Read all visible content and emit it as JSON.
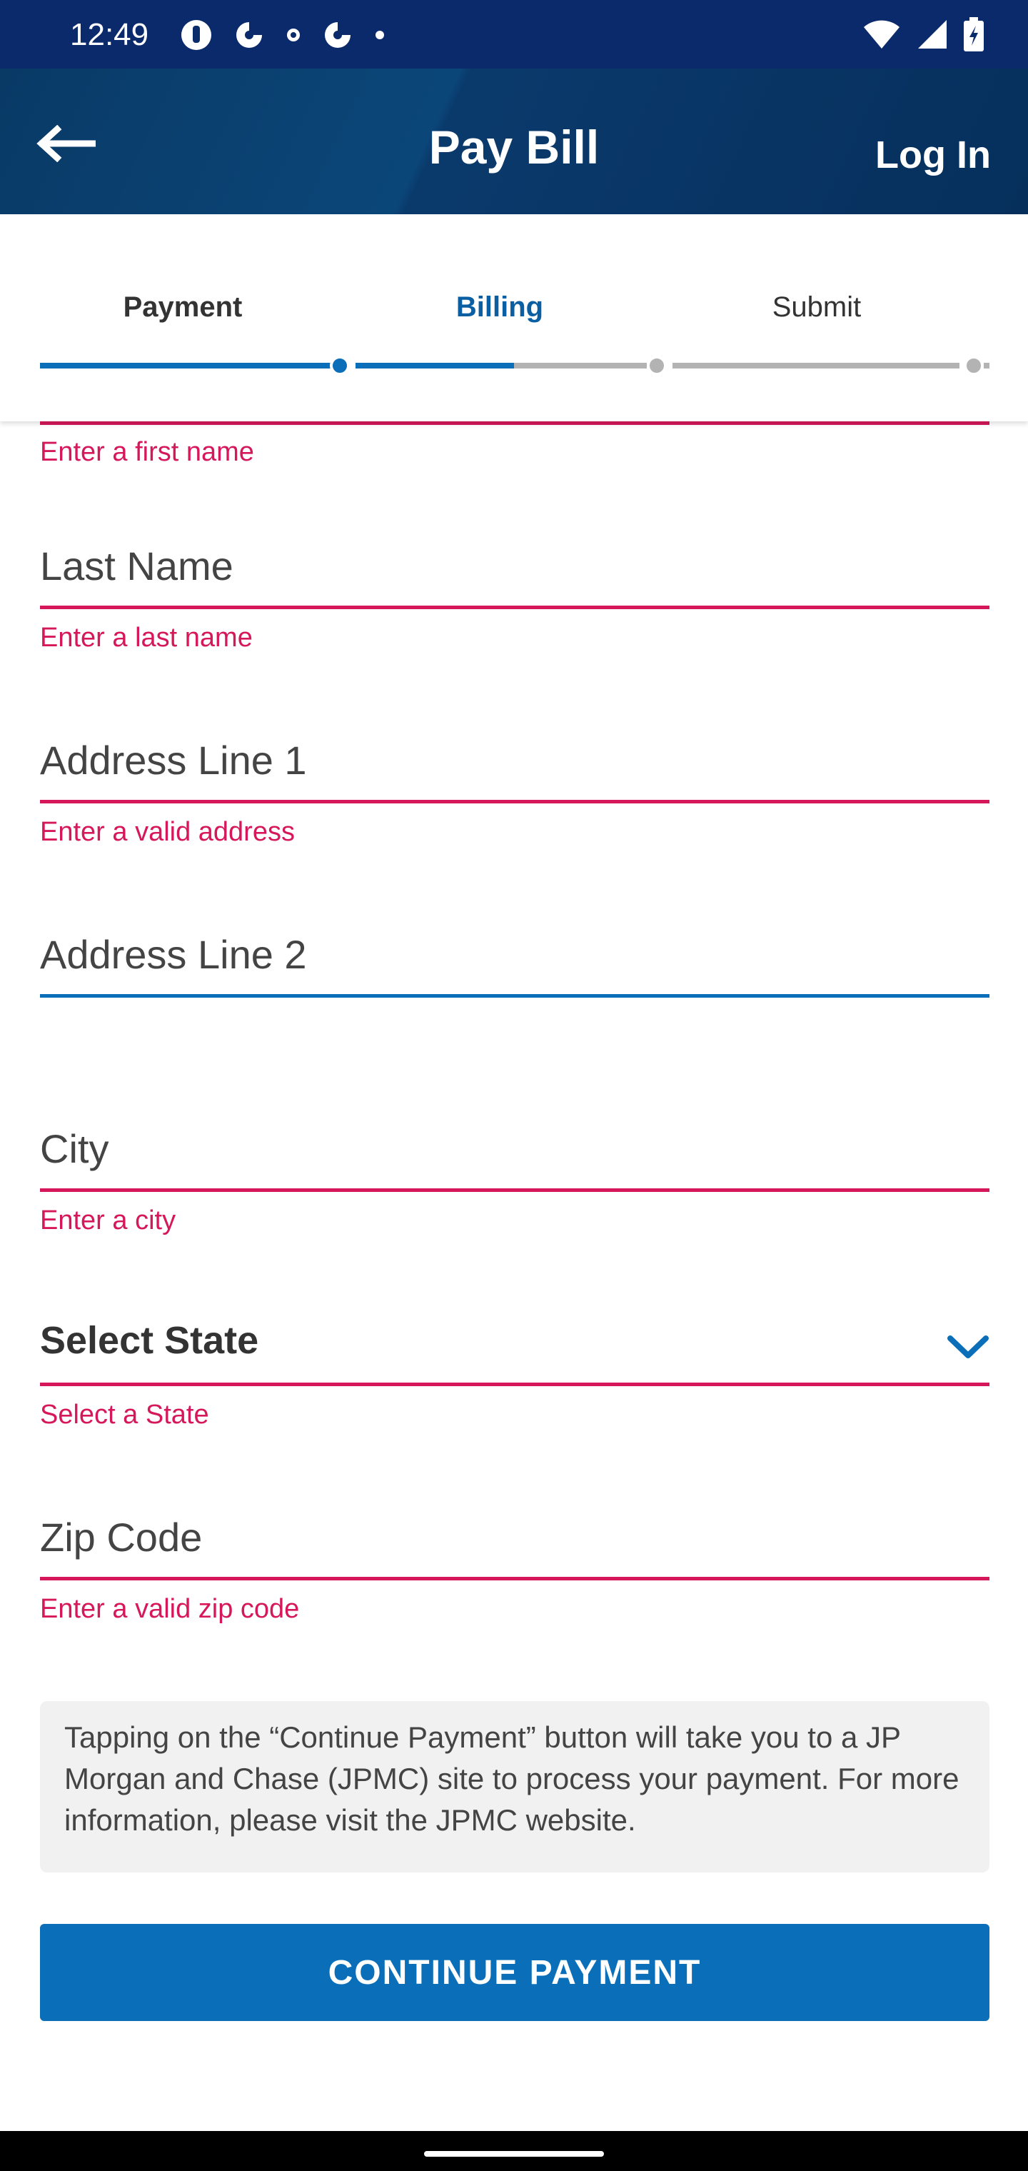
{
  "status_bar": {
    "time": "12:49",
    "left_icons": [
      "app-notification-icon",
      "app-notification-icon",
      "small-dot-icon",
      "app-notification-icon",
      "dot-icon"
    ],
    "right_icons": [
      "wifi-icon",
      "cellular-signal-icon",
      "battery-icon"
    ]
  },
  "header": {
    "title": "Pay Bill",
    "back_icon": "arrow-left-icon",
    "login_label": "Log In"
  },
  "stepper": {
    "steps": [
      {
        "label": "Payment",
        "state": "complete"
      },
      {
        "label": "Billing",
        "state": "current"
      },
      {
        "label": "Submit",
        "state": "upcoming"
      }
    ]
  },
  "form": {
    "first_name_error": "Enter a first name",
    "last_name": {
      "placeholder": "Last Name",
      "error": "Enter a last name"
    },
    "address1": {
      "placeholder": "Address Line 1",
      "error": "Enter a valid address"
    },
    "address2": {
      "placeholder": "Address Line 2"
    },
    "city": {
      "placeholder": "City",
      "error": "Enter a city"
    },
    "state": {
      "label": "Select State",
      "error": "Select a State"
    },
    "zip": {
      "placeholder": "Zip Code",
      "error": "Enter a valid zip code"
    }
  },
  "info": {
    "text": "Tapping on the “Continue Payment” button will take you to a JP Morgan and Chase (JPMC) site to process your payment. For more information, please visit the JPMC website."
  },
  "actions": {
    "continue_label": "CONTINUE PAYMENT"
  },
  "colors": {
    "header_bg": "#093a66",
    "status_bg": "#0b2a6b",
    "accent": "#0a6fb8",
    "error": "#d6185b",
    "progress_inactive": "#b3b3b3"
  }
}
